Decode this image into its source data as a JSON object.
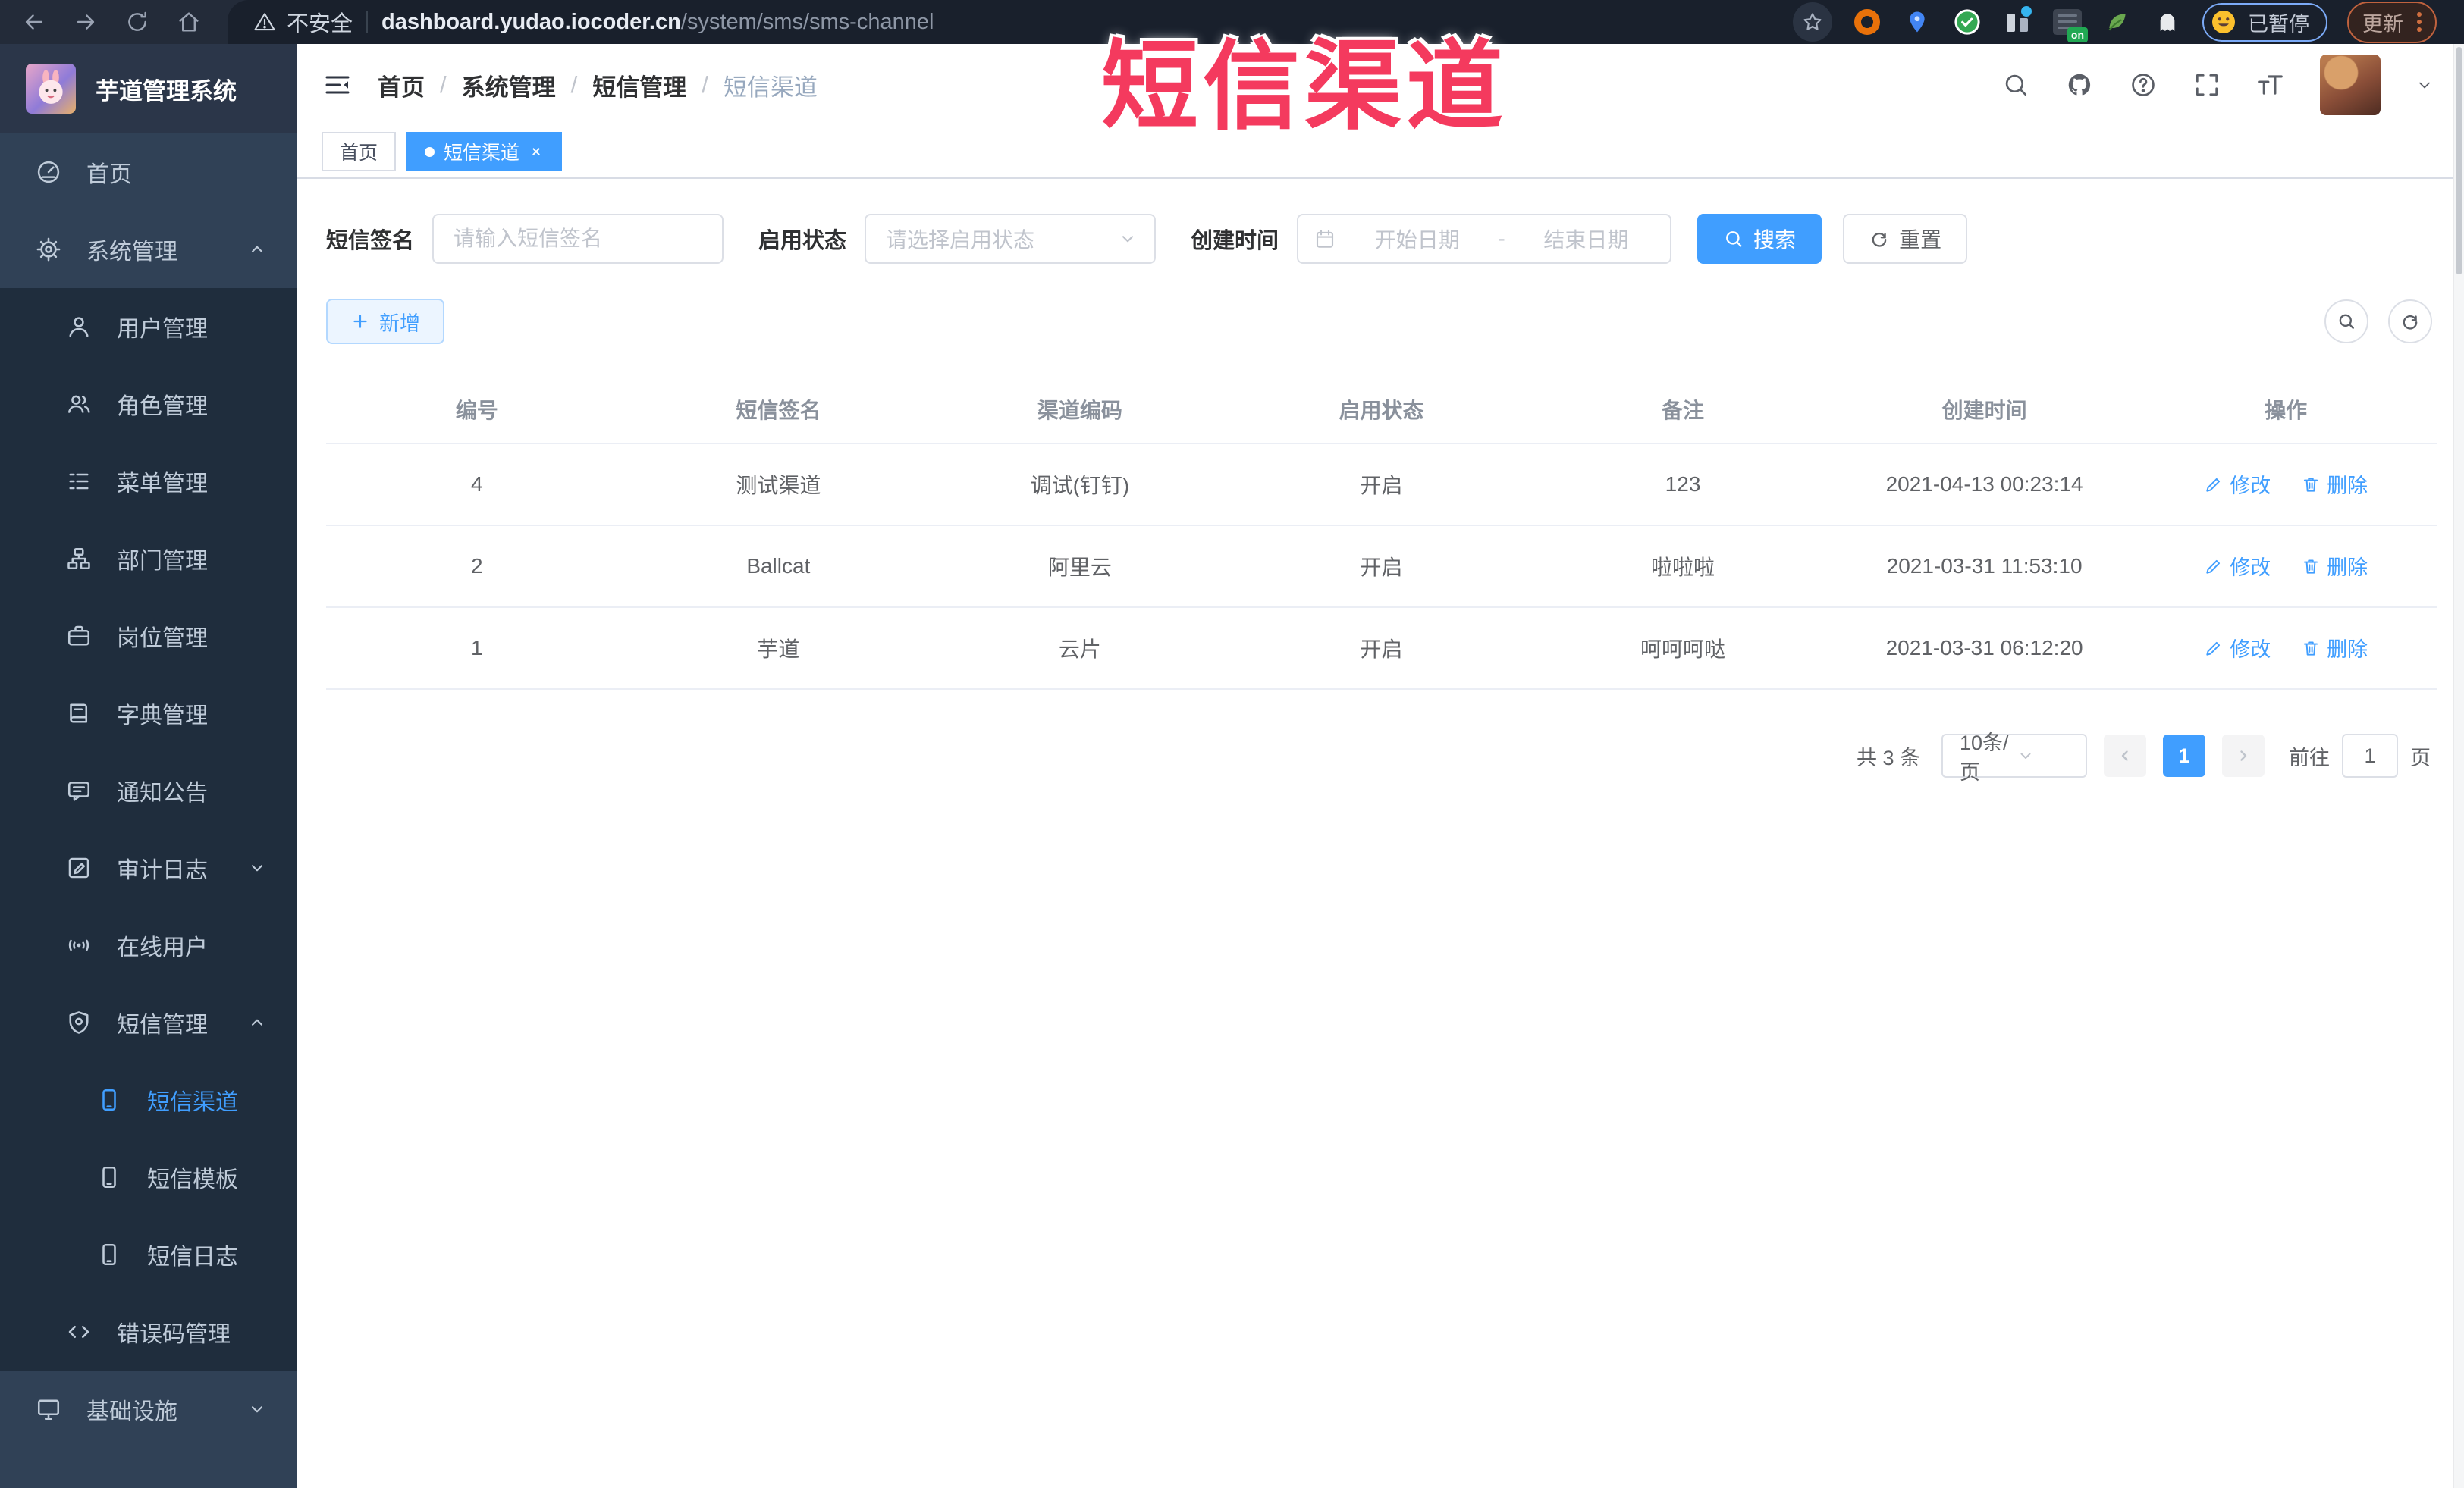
{
  "browser": {
    "security_label": "不安全",
    "url_host": "dashboard.yudao.iocoder.cn",
    "url_path": "/system/sms/sms-channel",
    "extension_badge": "on",
    "paused_label": "已暂停",
    "update_label": "更新"
  },
  "overlay": {
    "title": "短信渠道"
  },
  "sidebar": {
    "logo_title": "芋道管理系统",
    "items": [
      {
        "label": "首页",
        "icon": "dashboard-icon",
        "level": 1
      },
      {
        "label": "系统管理",
        "icon": "gear-icon",
        "level": 1,
        "state": "expanded"
      },
      {
        "label": "用户管理",
        "icon": "user-icon",
        "level": 2
      },
      {
        "label": "角色管理",
        "icon": "users-icon",
        "level": 2
      },
      {
        "label": "菜单管理",
        "icon": "menu-list-icon",
        "level": 2
      },
      {
        "label": "部门管理",
        "icon": "org-tree-icon",
        "level": 2
      },
      {
        "label": "岗位管理",
        "icon": "briefcase-icon",
        "level": 2
      },
      {
        "label": "字典管理",
        "icon": "dictionary-icon",
        "level": 2
      },
      {
        "label": "通知公告",
        "icon": "announcement-icon",
        "level": 2
      },
      {
        "label": "审计日志",
        "icon": "audit-log-icon",
        "level": 2,
        "state": "collapsed"
      },
      {
        "label": "在线用户",
        "icon": "online-users-icon",
        "level": 2
      },
      {
        "label": "短信管理",
        "icon": "sms-shield-icon",
        "level": 2,
        "state": "expanded"
      },
      {
        "label": "短信渠道",
        "icon": "phone-icon",
        "level": 3,
        "active": true
      },
      {
        "label": "短信模板",
        "icon": "phone-icon",
        "level": 3
      },
      {
        "label": "短信日志",
        "icon": "phone-icon",
        "level": 3
      },
      {
        "label": "错误码管理",
        "icon": "code-icon",
        "level": 2
      },
      {
        "label": "基础设施",
        "icon": "monitor-icon",
        "level": 1,
        "state": "collapsed"
      }
    ]
  },
  "navbar": {
    "breadcrumbs": [
      "首页",
      "系统管理",
      "短信管理",
      "短信渠道"
    ],
    "separator": "/"
  },
  "tabs": {
    "items": [
      {
        "label": "首页",
        "active": false
      },
      {
        "label": "短信渠道",
        "active": true,
        "closable": true
      }
    ]
  },
  "filters": {
    "sign_label": "短信签名",
    "sign_placeholder": "请输入短信签名",
    "status_label": "启用状态",
    "status_placeholder": "请选择启用状态",
    "time_label": "创建时间",
    "date_start_placeholder": "开始日期",
    "date_separator": "-",
    "date_end_placeholder": "结束日期",
    "search_label": "搜索",
    "reset_label": "重置"
  },
  "toolbar": {
    "add_label": "新增"
  },
  "table": {
    "columns": [
      "编号",
      "短信签名",
      "渠道编码",
      "启用状态",
      "备注",
      "创建时间",
      "操作"
    ],
    "rows": [
      {
        "id": "4",
        "sign": "测试渠道",
        "code": "调试(钉钉)",
        "status": "开启",
        "remark": "123",
        "created": "2021-04-13 00:23:14"
      },
      {
        "id": "2",
        "sign": "Ballcat",
        "code": "阿里云",
        "status": "开启",
        "remark": "啦啦啦",
        "created": "2021-03-31 11:53:10"
      },
      {
        "id": "1",
        "sign": "芋道",
        "code": "云片",
        "status": "开启",
        "remark": "呵呵呵哒",
        "created": "2021-03-31 06:12:20"
      }
    ],
    "edit_label": "修改",
    "delete_label": "删除"
  },
  "pagination": {
    "total_text": "共 3 条",
    "page_size": "10条/页",
    "current_page": "1",
    "goto_label": "前往",
    "goto_value": "1",
    "page_unit": "页"
  },
  "colors": {
    "accent": "#409eff",
    "overlay_red": "#f43a5e",
    "sidebar_bg": "#304156",
    "submenu_bg": "#1f2d3d"
  }
}
